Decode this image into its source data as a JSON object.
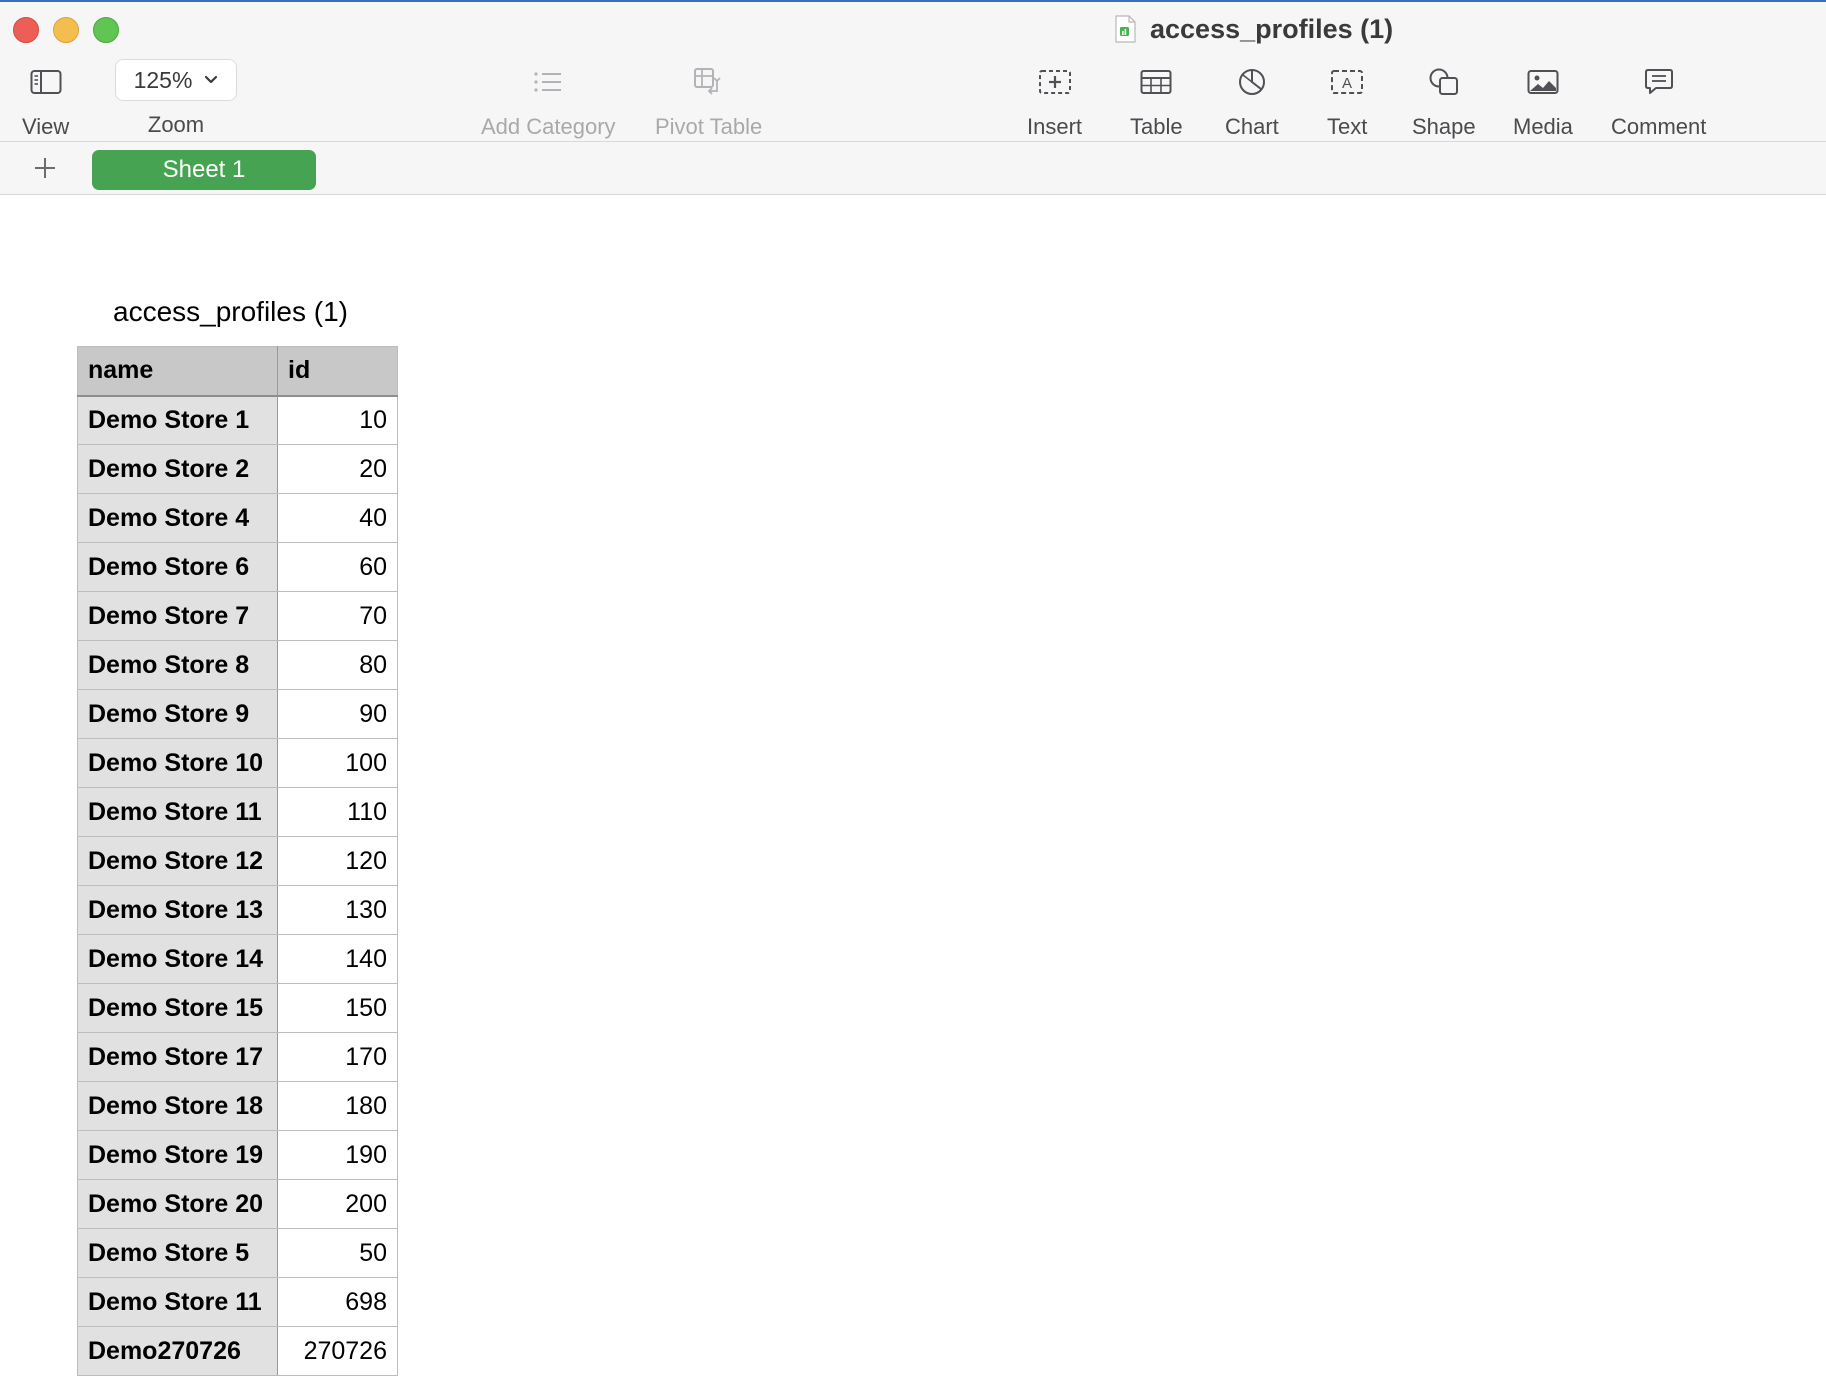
{
  "window": {
    "title": "access_profiles (1)"
  },
  "toolbar": {
    "view_label": "View",
    "zoom_value": "125%",
    "zoom_label": "Zoom",
    "add_category_label": "Add Category",
    "pivot_table_label": "Pivot Table",
    "insert_label": "Insert",
    "table_label": "Table",
    "chart_label": "Chart",
    "text_label": "Text",
    "text_icon_glyph": "A",
    "shape_label": "Shape",
    "media_label": "Media",
    "comment_label": "Comment"
  },
  "sheets": {
    "add_icon": "plus-icon",
    "tabs": [
      {
        "label": "Sheet 1",
        "active": true
      }
    ]
  },
  "table": {
    "title": "access_profiles (1)",
    "columns": [
      "name",
      "id"
    ],
    "rows": [
      {
        "name": "Demo Store 1",
        "id": "10"
      },
      {
        "name": "Demo Store 2",
        "id": "20"
      },
      {
        "name": "Demo Store 4",
        "id": "40"
      },
      {
        "name": "Demo Store 6",
        "id": "60"
      },
      {
        "name": "Demo Store 7",
        "id": "70"
      },
      {
        "name": "Demo Store 8",
        "id": "80"
      },
      {
        "name": "Demo Store 9",
        "id": "90"
      },
      {
        "name": "Demo Store 10",
        "id": "100"
      },
      {
        "name": "Demo Store 11",
        "id": "110"
      },
      {
        "name": "Demo Store 12",
        "id": "120"
      },
      {
        "name": "Demo Store 13",
        "id": "130"
      },
      {
        "name": "Demo Store 14",
        "id": "140"
      },
      {
        "name": "Demo Store 15",
        "id": "150"
      },
      {
        "name": "Demo Store 17",
        "id": "170"
      },
      {
        "name": "Demo Store 18",
        "id": "180"
      },
      {
        "name": "Demo Store 19",
        "id": "190"
      },
      {
        "name": "Demo Store 20",
        "id": "200"
      },
      {
        "name": "Demo Store 5",
        "id": "50"
      },
      {
        "name": "Demo Store 11",
        "id": "698"
      },
      {
        "name": "Demo270726",
        "id": "270726"
      }
    ]
  },
  "colors": {
    "sheet_tab_active": "#46a352",
    "header_fill": "#c8c8c8",
    "name_column_fill": "#e1e1e1",
    "toolbar_bg": "#f6f6f7"
  }
}
